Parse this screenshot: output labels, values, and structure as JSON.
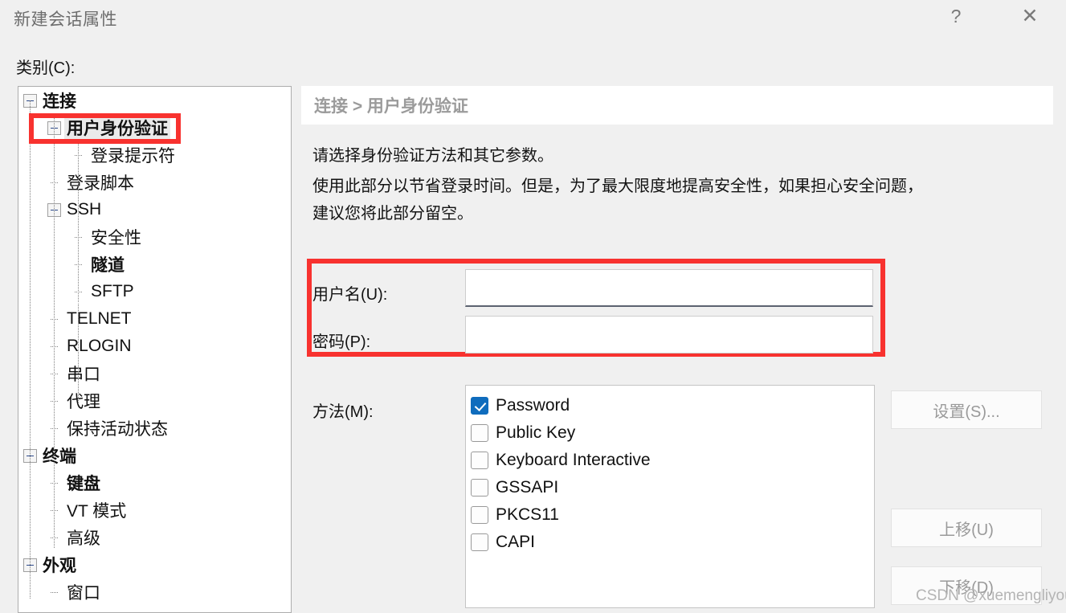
{
  "window": {
    "title": "新建会话属性",
    "help_icon": "question-mark-icon",
    "close_icon": "close-icon"
  },
  "category": {
    "label": "类别(C):",
    "tree": [
      {
        "label": "连接",
        "level": 0,
        "bold": true,
        "expander": true,
        "selected": false
      },
      {
        "label": "用户身份验证",
        "level": 1,
        "bold": true,
        "expander": true,
        "selected": true
      },
      {
        "label": "登录提示符",
        "level": 2,
        "bold": false,
        "expander": false,
        "selected": false
      },
      {
        "label": "登录脚本",
        "level": 1,
        "bold": false,
        "expander": false,
        "selected": false
      },
      {
        "label": "SSH",
        "level": 1,
        "bold": false,
        "expander": true,
        "selected": false
      },
      {
        "label": "安全性",
        "level": 2,
        "bold": false,
        "expander": false,
        "selected": false
      },
      {
        "label": "隧道",
        "level": 2,
        "bold": true,
        "expander": false,
        "selected": false
      },
      {
        "label": "SFTP",
        "level": 2,
        "bold": false,
        "expander": false,
        "selected": false
      },
      {
        "label": "TELNET",
        "level": 1,
        "bold": false,
        "expander": false,
        "selected": false
      },
      {
        "label": "RLOGIN",
        "level": 1,
        "bold": false,
        "expander": false,
        "selected": false
      },
      {
        "label": "串口",
        "level": 1,
        "bold": false,
        "expander": false,
        "selected": false
      },
      {
        "label": "代理",
        "level": 1,
        "bold": false,
        "expander": false,
        "selected": false
      },
      {
        "label": "保持活动状态",
        "level": 1,
        "bold": false,
        "expander": false,
        "selected": false
      },
      {
        "label": "终端",
        "level": 0,
        "bold": true,
        "expander": true,
        "selected": false
      },
      {
        "label": "键盘",
        "level": 1,
        "bold": true,
        "expander": false,
        "selected": false
      },
      {
        "label": "VT 模式",
        "level": 1,
        "bold": false,
        "expander": false,
        "selected": false
      },
      {
        "label": "高级",
        "level": 1,
        "bold": false,
        "expander": false,
        "selected": false
      },
      {
        "label": "外观",
        "level": 0,
        "bold": true,
        "expander": true,
        "selected": false
      },
      {
        "label": "窗口",
        "level": 1,
        "bold": false,
        "expander": false,
        "selected": false
      }
    ]
  },
  "content": {
    "breadcrumb": "连接 > 用户身份验证",
    "description_line1": "请选择身份验证方法和其它参数。",
    "description_line2": "使用此部分以节省登录时间。但是，为了最大限度地提高安全性，如果担心安全问题，",
    "description_line3": "建议您将此部分留空。",
    "username_label": "用户名(U):",
    "username_value": "",
    "password_label": "密码(P):",
    "password_value": "",
    "method_label": "方法(M):",
    "methods": [
      {
        "label": "Password",
        "checked": true
      },
      {
        "label": "Public Key",
        "checked": false
      },
      {
        "label": "Keyboard Interactive",
        "checked": false
      },
      {
        "label": "GSSAPI",
        "checked": false
      },
      {
        "label": "PKCS11",
        "checked": false
      },
      {
        "label": "CAPI",
        "checked": false
      }
    ],
    "buttons": {
      "settings": "设置(S)...",
      "move_up": "上移(U)",
      "move_down": "下移(D)"
    }
  },
  "watermark": "CSDN @xuemengliyou",
  "colors": {
    "accent_checkbox": "#0f6cbd",
    "annotation_red": "#f8322f",
    "dialog_bg": "#f0f0f0",
    "panel_bg": "#ffffff",
    "disabled_text": "#9a9a9a"
  }
}
